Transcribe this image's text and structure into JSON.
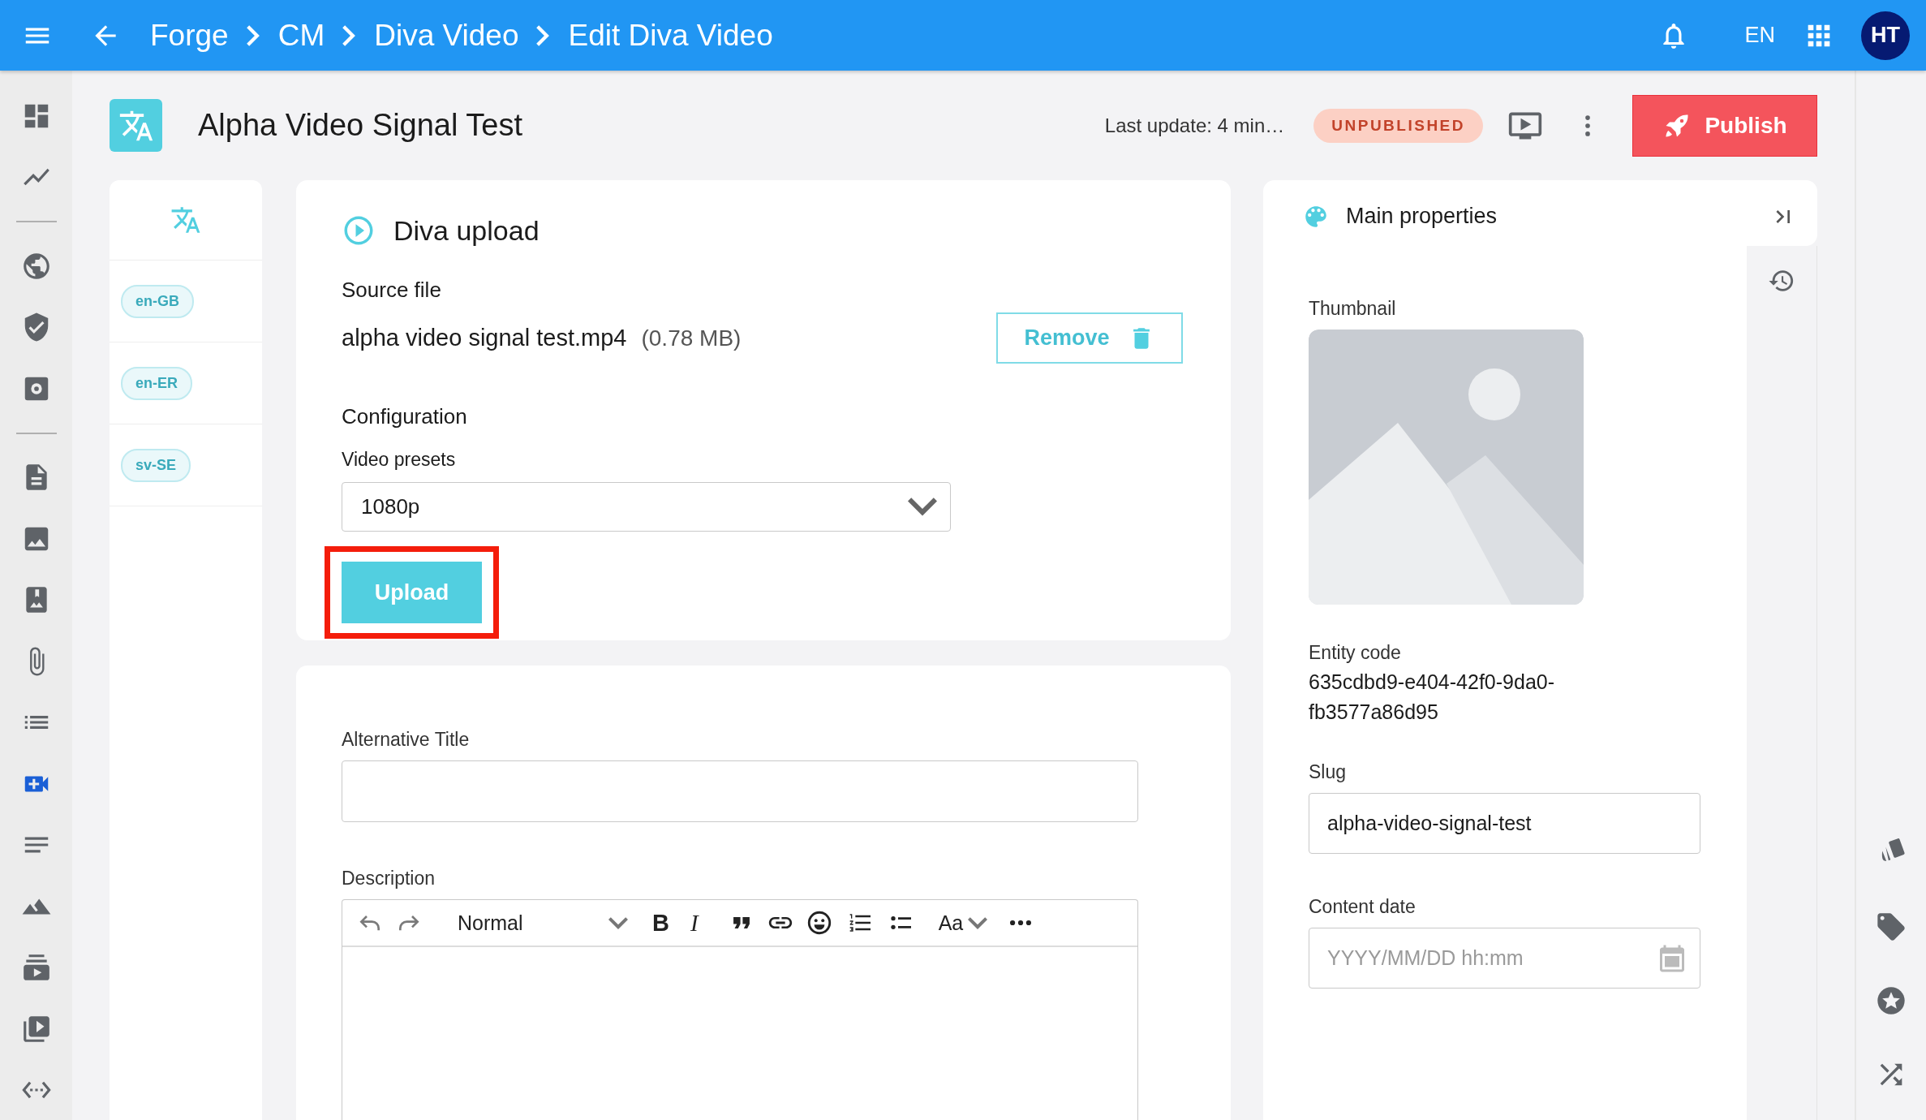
{
  "top_bar": {
    "breadcrumbs": [
      "Forge",
      "CM",
      "Diva Video",
      "Edit Diva Video"
    ],
    "language": "EN",
    "avatar": "HT"
  },
  "nav_items": [
    {
      "selected": false
    },
    {
      "selected": false
    },
    {
      "selected": false
    },
    {
      "selected": false
    },
    {
      "selected": false
    },
    {
      "selected": false
    },
    {
      "selected": false
    },
    {
      "selected": false
    },
    {
      "selected": false
    },
    {
      "selected": false
    },
    {
      "selected": true
    },
    {
      "selected": false
    },
    {
      "selected": false
    },
    {
      "selected": false
    },
    {
      "selected": false
    },
    {
      "selected": false
    }
  ],
  "header": {
    "title": "Alpha Video Signal Test",
    "last_update": "Last update: 4 min…",
    "status": "UNPUBLISHED",
    "publish_button": "Publish"
  },
  "languages": [
    "en-GB",
    "en-ER",
    "sv-SE"
  ],
  "upload_card": {
    "title": "Diva upload",
    "source_label": "Source file",
    "file_name": "alpha video signal test.mp4",
    "file_size": "(0.78 MB)",
    "remove_button": "Remove",
    "config_label": "Configuration",
    "presets_label": "Video presets",
    "preset_value": "1080p",
    "upload_button": "Upload",
    "upload_highlighted": true
  },
  "fields_card": {
    "alt_title_label": "Alternative Title",
    "description_label": "Description",
    "editor_toolbar": {
      "block_style": "Normal",
      "bold": "B",
      "italic": "I",
      "font_size": "Aa"
    }
  },
  "properties": {
    "title": "Main properties",
    "thumbnail_label": "Thumbnail",
    "entity_code_label": "Entity code",
    "entity_code": "635cdbd9-e404-42f0-9da0-fb3577a86d95",
    "slug_label": "Slug",
    "slug": "alpha-video-signal-test",
    "content_date_label": "Content date",
    "content_date_placeholder": "YYYY/MM/DD hh:mm"
  }
}
